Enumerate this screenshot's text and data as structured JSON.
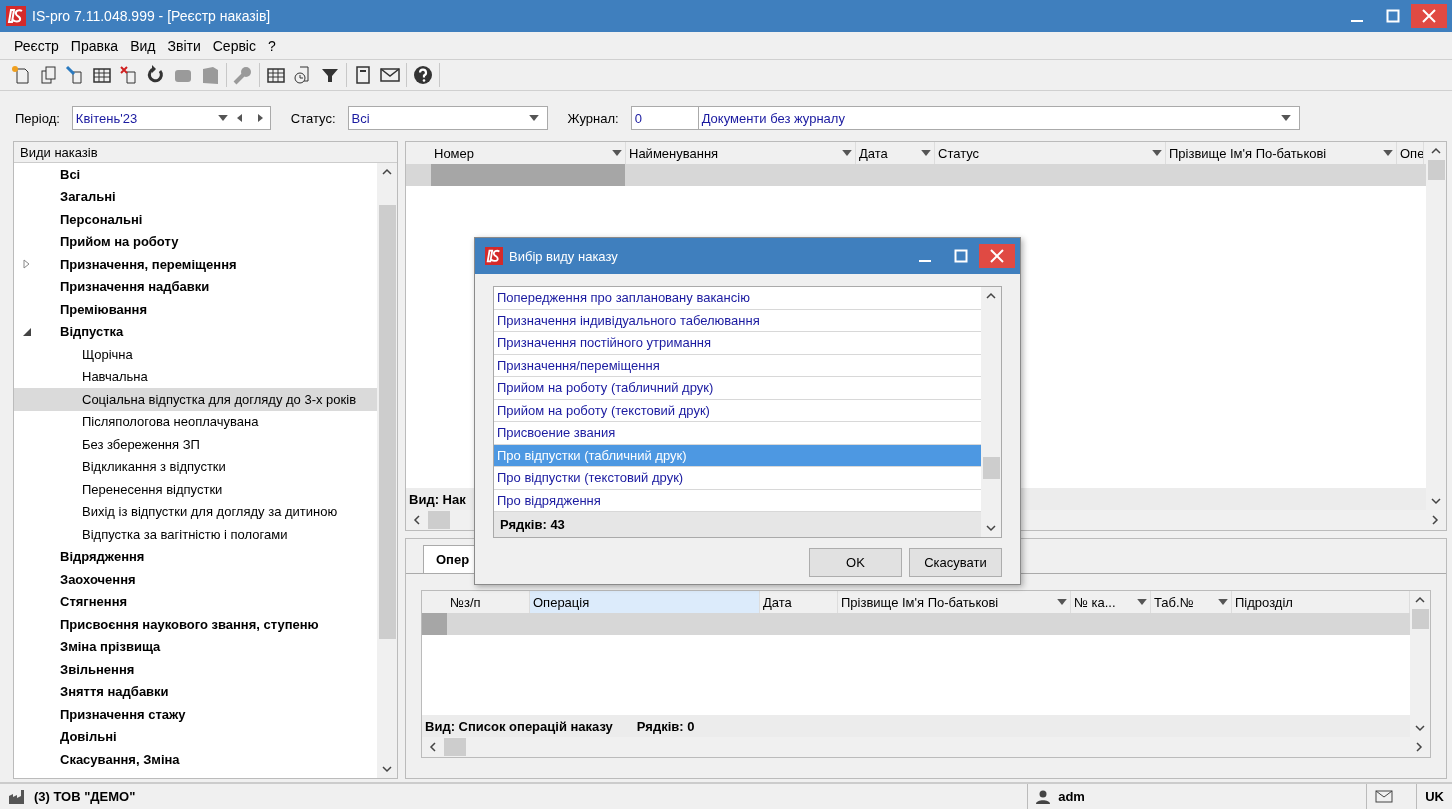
{
  "window": {
    "title": "IS-pro 7.11.048.999 - [Реєстр наказів]"
  },
  "menu": [
    "Реєстр",
    "Правка",
    "Вид",
    "Звіти",
    "Сервіс",
    "?"
  ],
  "toolbar": [
    [
      {
        "kind": "new",
        "disabled": false
      },
      {
        "kind": "copy",
        "disabled": false
      },
      {
        "kind": "pin",
        "disabled": false
      },
      {
        "kind": "table",
        "disabled": false
      },
      {
        "kind": "delete",
        "disabled": false
      },
      {
        "kind": "refresh",
        "disabled": false
      },
      {
        "kind": "block",
        "disabled": true
      },
      {
        "kind": "page",
        "disabled": true
      }
    ],
    [
      {
        "kind": "key",
        "disabled": true
      }
    ],
    [
      {
        "kind": "table",
        "disabled": false
      },
      {
        "kind": "clock",
        "disabled": false
      },
      {
        "kind": "filter",
        "disabled": false
      }
    ],
    [
      {
        "kind": "notebook",
        "disabled": false
      },
      {
        "kind": "mail",
        "disabled": false
      }
    ],
    [
      {
        "kind": "help",
        "disabled": false
      }
    ]
  ],
  "filters": {
    "period_label": "Період:",
    "period_value": "Квітень'23",
    "status_label": "Статус:",
    "status_value": "Всі",
    "journal_label": "Журнал:",
    "journal_code": "0",
    "journal_value": "Документи без журналу"
  },
  "order_types": {
    "title": "Види наказів",
    "items": [
      {
        "label": "Всі",
        "selected": false
      },
      {
        "label": "Загальні",
        "selected": false
      },
      {
        "label": "Персональні",
        "selected": false
      },
      {
        "label": "Прийом на роботу",
        "selected": false
      },
      {
        "label": "Призначення, переміщення",
        "selected": false,
        "expanded": false
      },
      {
        "label": "Призначення надбавки",
        "selected": false
      },
      {
        "label": "Преміювання",
        "selected": false
      },
      {
        "label": "Відпустка",
        "selected": false,
        "expanded": true,
        "children": [
          {
            "label": "Щорічна",
            "selected": false
          },
          {
            "label": "Навчальна",
            "selected": false
          },
          {
            "label": "Соціальна відпустка для догляду до 3-х років",
            "selected": true
          },
          {
            "label": "Післяпологова неоплачувана",
            "selected": false
          },
          {
            "label": "Без збереження ЗП",
            "selected": false
          },
          {
            "label": "Відкликання з відпустки",
            "selected": false
          },
          {
            "label": "Перенесення відпустки",
            "selected": false
          },
          {
            "label": "Вихід із відпустки для догляду за дитиною",
            "selected": false
          },
          {
            "label": "Відпустка за вагітністю і пологами",
            "selected": false
          }
        ]
      },
      {
        "label": "Відрядження",
        "selected": false
      },
      {
        "label": "Заохочення",
        "selected": false
      },
      {
        "label": "Стягнення",
        "selected": false
      },
      {
        "label": "Присвоєння наукового звання, ступеню",
        "selected": false
      },
      {
        "label": "Зміна прізвища",
        "selected": false
      },
      {
        "label": "Звільнення",
        "selected": false
      },
      {
        "label": "Зняття надбавки",
        "selected": false
      },
      {
        "label": "Призначення стажу",
        "selected": false
      },
      {
        "label": "Довільні",
        "selected": false
      },
      {
        "label": "Скасування, Зміна",
        "selected": false
      }
    ]
  },
  "orders_table": {
    "columns": [
      "Номер",
      "Найменування",
      "Дата",
      "Статус",
      "Прізвище Ім'я По-батькові",
      "Опе"
    ],
    "footer": "Вид: Нак"
  },
  "operations": {
    "tab": "Опер",
    "columns": [
      {
        "label": "№з/п",
        "selected": false
      },
      {
        "label": "Операція",
        "selected": true
      },
      {
        "label": "Дата",
        "selected": false
      },
      {
        "label": "Прізвище Ім'я По-батькові",
        "selected": false
      },
      {
        "label": "№ ка...",
        "selected": false
      },
      {
        "label": "Таб.№",
        "selected": false
      },
      {
        "label": "Підрозділ",
        "selected": false
      }
    ],
    "footer_view": "Вид: Список операцій наказу",
    "footer_rows": "Рядків: 0"
  },
  "dialog": {
    "title": "Вибір виду наказу",
    "items": [
      {
        "label": "Попередження про заплановану вакансію",
        "selected": false
      },
      {
        "label": "Призначення індивідуального табелювання",
        "selected": false
      },
      {
        "label": "Призначення постійного утримання",
        "selected": false
      },
      {
        "label": "Призначення/переміщення",
        "selected": false
      },
      {
        "label": "Прийом на роботу (табличний друк)",
        "selected": false
      },
      {
        "label": "Прийом на роботу (текстовий друк)",
        "selected": false
      },
      {
        "label": "Присвоение звания",
        "selected": false
      },
      {
        "label": "Про відпустки (табличний друк)",
        "selected": true
      },
      {
        "label": "Про відпустки (текстовий друк)",
        "selected": false
      },
      {
        "label": "Про відрядження",
        "selected": false
      }
    ],
    "rows": "Рядків: 43",
    "buttons": [
      "OK",
      "Скасувати"
    ]
  },
  "status_bar": {
    "company": "(3) ТОВ \"ДЕМО\"",
    "user": "adm",
    "language": "UK"
  }
}
